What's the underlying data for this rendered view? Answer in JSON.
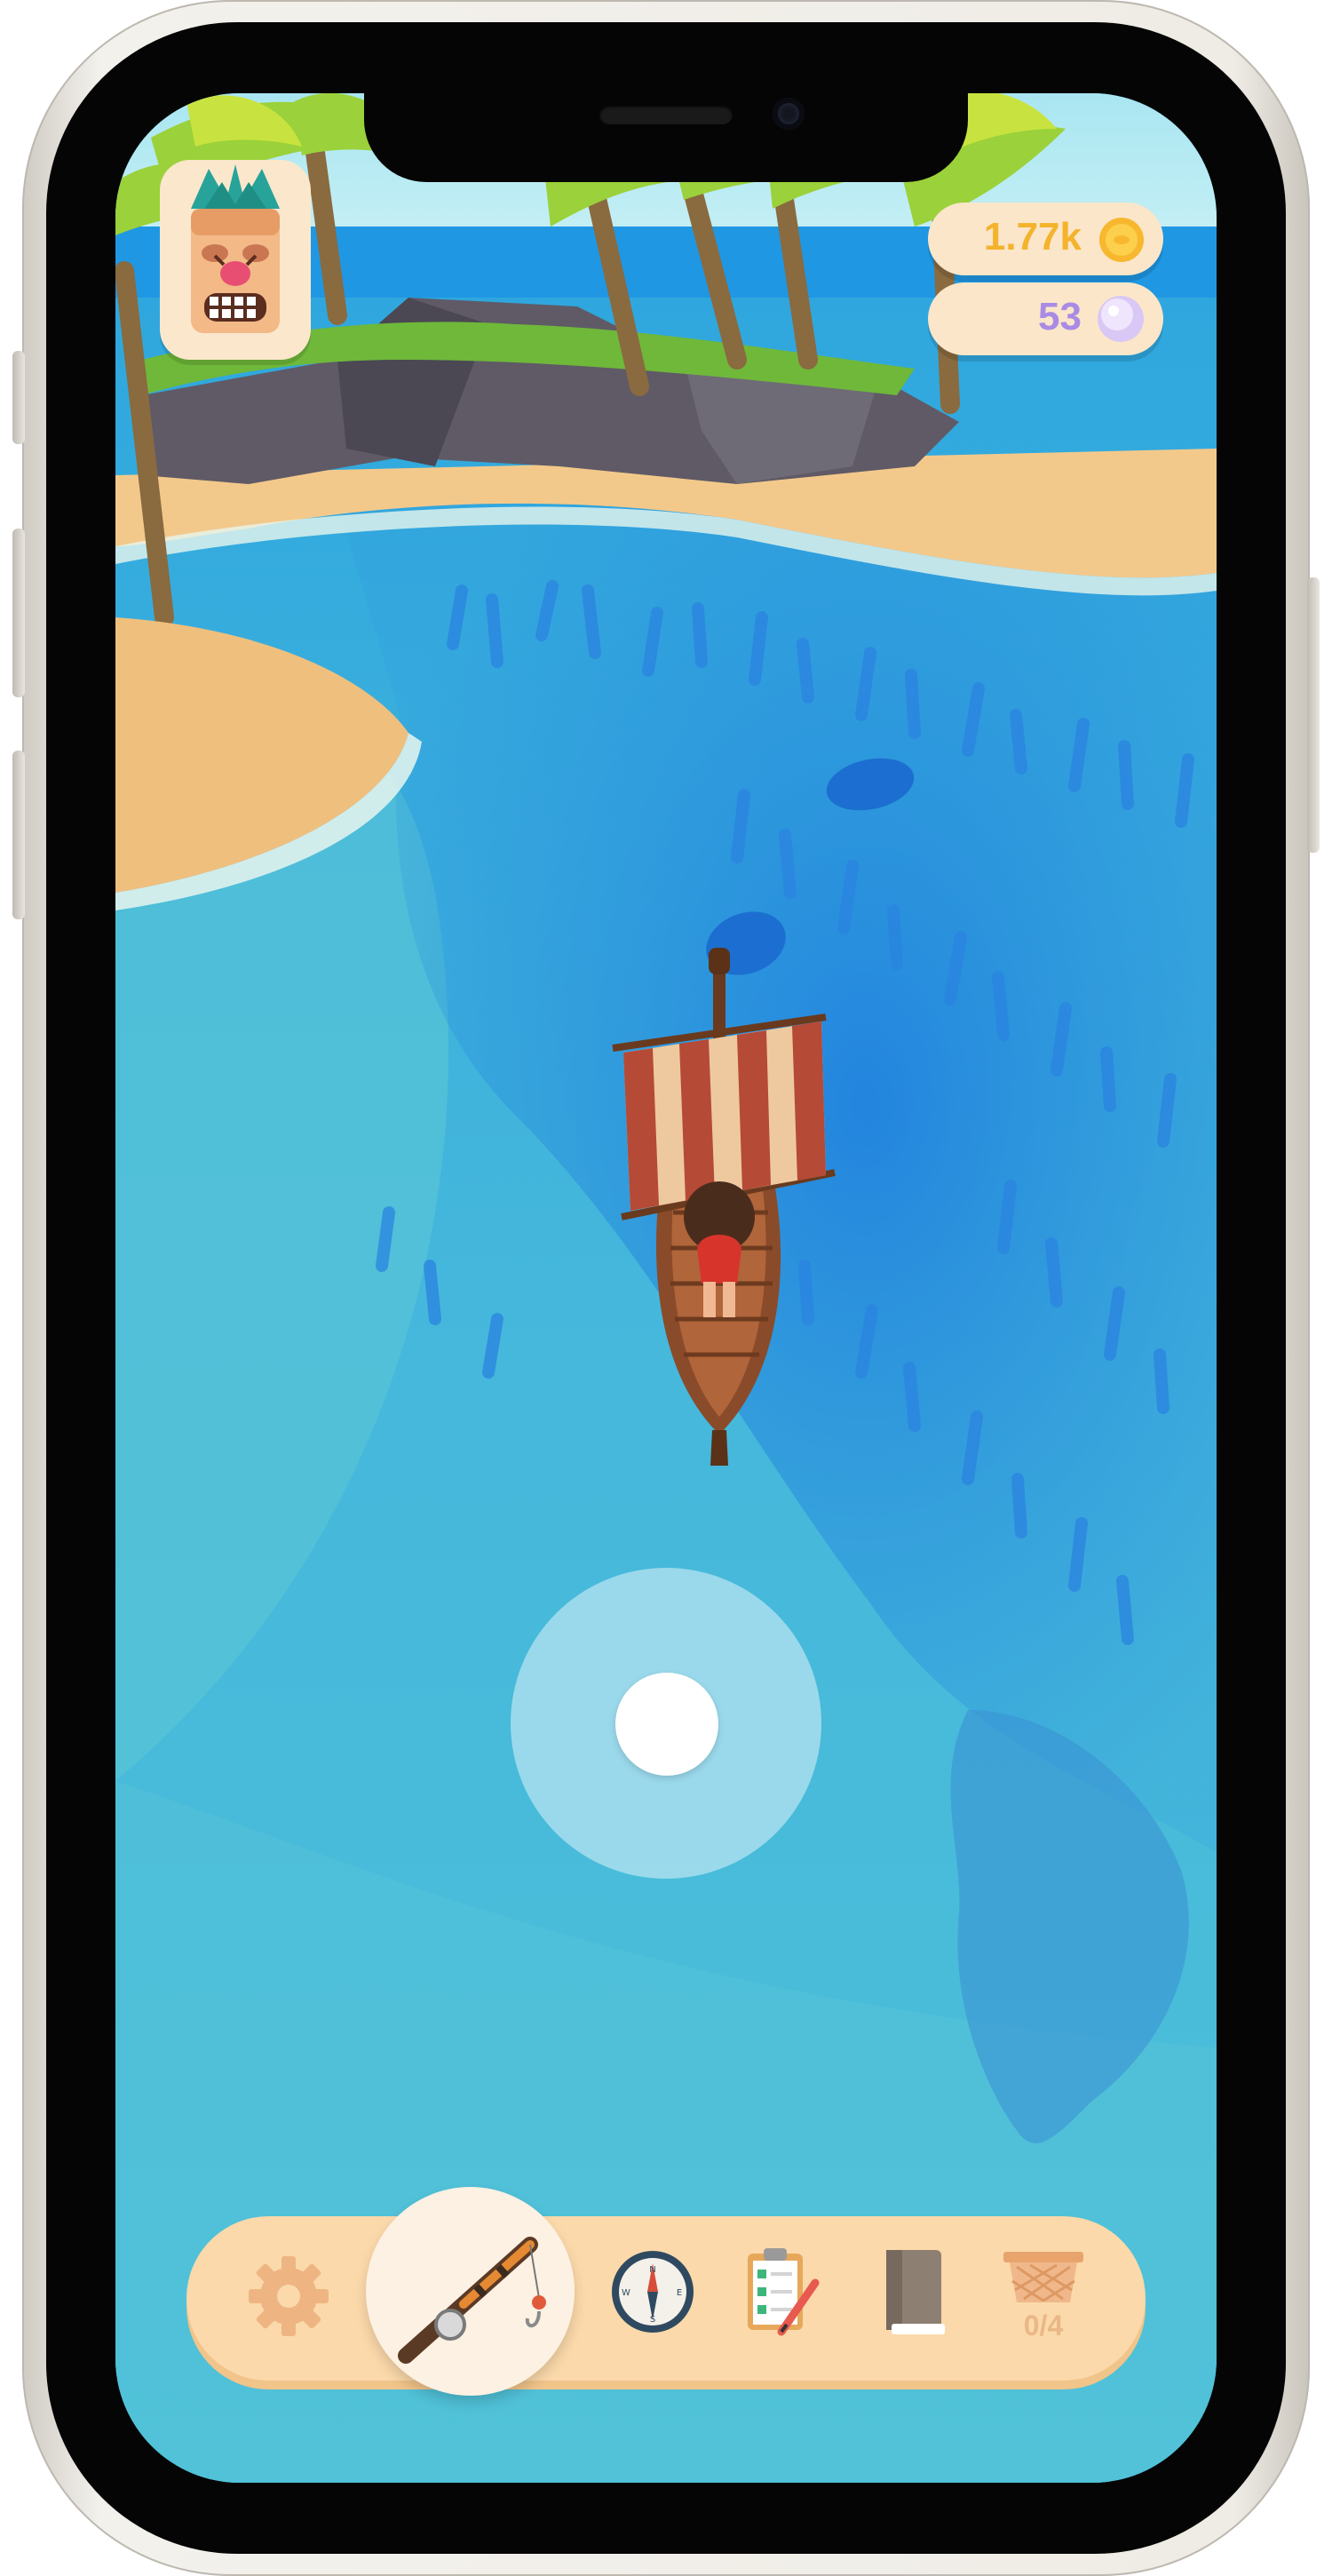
{
  "hud": {
    "coins": {
      "value": "1.77k",
      "icon": "gold-coin-icon",
      "color": "#f4b32c"
    },
    "pearls": {
      "value": "53",
      "icon": "pearl-icon",
      "color": "#a98be6"
    },
    "avatar": {
      "icon": "tiki-mask-icon"
    }
  },
  "toolbar": {
    "buttons": [
      {
        "icon": "gear-icon"
      },
      {
        "icon": "fishing-rod-icon",
        "selected": true
      },
      {
        "icon": "compass-icon"
      },
      {
        "icon": "clipboard-checklist-icon"
      },
      {
        "icon": "book-icon"
      },
      {
        "icon": "basket-icon",
        "count": "0/4"
      }
    ]
  },
  "joystick": {
    "icon": "joystick"
  },
  "colors": {
    "sea": "#3bb5df",
    "ui_panel": "#fbd9aa",
    "ui_light": "#fbe6c9"
  }
}
